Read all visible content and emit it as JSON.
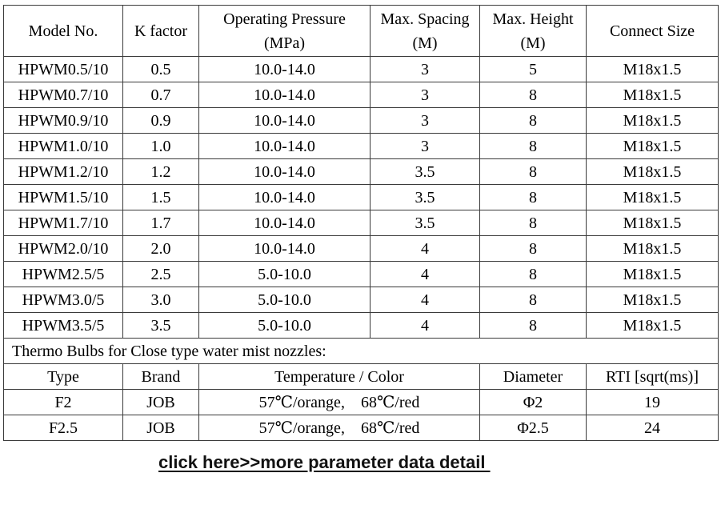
{
  "main_table": {
    "headers": [
      "Model No.",
      "K factor",
      "Operating Pressure\n(MPa)",
      "Max. Spacing\n(M)",
      "Max. Height\n(M)",
      "Connect Size"
    ],
    "headers_lines": [
      [
        "Model No."
      ],
      [
        "K factor"
      ],
      [
        "Operating Pressure",
        "(MPa)"
      ],
      [
        "Max. Spacing",
        "(M)"
      ],
      [
        "Max. Height",
        "(M)"
      ],
      [
        "Connect Size"
      ]
    ],
    "rows": [
      [
        "HPWM0.5/10",
        "0.5",
        "10.0-14.0",
        "3",
        "5",
        "M18x1.5"
      ],
      [
        "HPWM0.7/10",
        "0.7",
        "10.0-14.0",
        "3",
        "8",
        "M18x1.5"
      ],
      [
        "HPWM0.9/10",
        "0.9",
        "10.0-14.0",
        "3",
        "8",
        "M18x1.5"
      ],
      [
        "HPWM1.0/10",
        "1.0",
        "10.0-14.0",
        "3",
        "8",
        "M18x1.5"
      ],
      [
        "HPWM1.2/10",
        "1.2",
        "10.0-14.0",
        "3.5",
        "8",
        "M18x1.5"
      ],
      [
        "HPWM1.5/10",
        "1.5",
        "10.0-14.0",
        "3.5",
        "8",
        "M18x1.5"
      ],
      [
        "HPWM1.7/10",
        "1.7",
        "10.0-14.0",
        "3.5",
        "8",
        "M18x1.5"
      ],
      [
        "HPWM2.0/10",
        "2.0",
        "10.0-14.0",
        "4",
        "8",
        "M18x1.5"
      ],
      [
        "HPWM2.5/5",
        "2.5",
        "5.0-10.0",
        "4",
        "8",
        "M18x1.5"
      ],
      [
        "HPWM3.0/5",
        "3.0",
        "5.0-10.0",
        "4",
        "8",
        "M18x1.5"
      ],
      [
        "HPWM3.5/5",
        "3.5",
        "5.0-10.0",
        "4",
        "8",
        "M18x1.5"
      ]
    ]
  },
  "bulbs_table": {
    "caption": "Thermo Bulbs for Close type water mist nozzles:",
    "headers": [
      "Type",
      "Brand",
      "Temperature / Color",
      "Diameter",
      "RTI [sqrt(ms)]"
    ],
    "rows": [
      [
        "F2",
        "JOB",
        "57℃/orange,    68℃/red",
        "Φ2",
        "19"
      ],
      [
        "F2.5",
        "JOB",
        "57℃/orange,    68℃/red",
        "Φ2.5",
        "24"
      ]
    ]
  },
  "link": {
    "label": "click here>>more parameter data detail "
  }
}
